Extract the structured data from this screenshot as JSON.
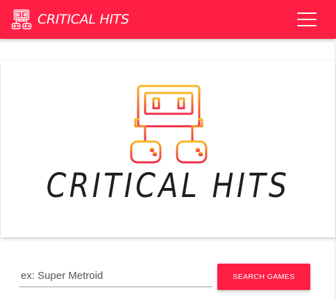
{
  "navbar": {
    "brand_text": "CRITICAL HITS",
    "brand_icon": "arcade-controllers-icon",
    "menu_icon": "hamburger-menu-icon",
    "background_color": "#ff1f44"
  },
  "hero": {
    "logo_icon": "arcade-controllers-logo-icon",
    "title": "CRITICAL HITS",
    "logo_gradient": [
      "#f8b625",
      "#f5612f",
      "#ef2f45"
    ]
  },
  "search": {
    "placeholder": "ex: Super Metroid",
    "value": "",
    "button_label": "SEARCH GAMES"
  }
}
